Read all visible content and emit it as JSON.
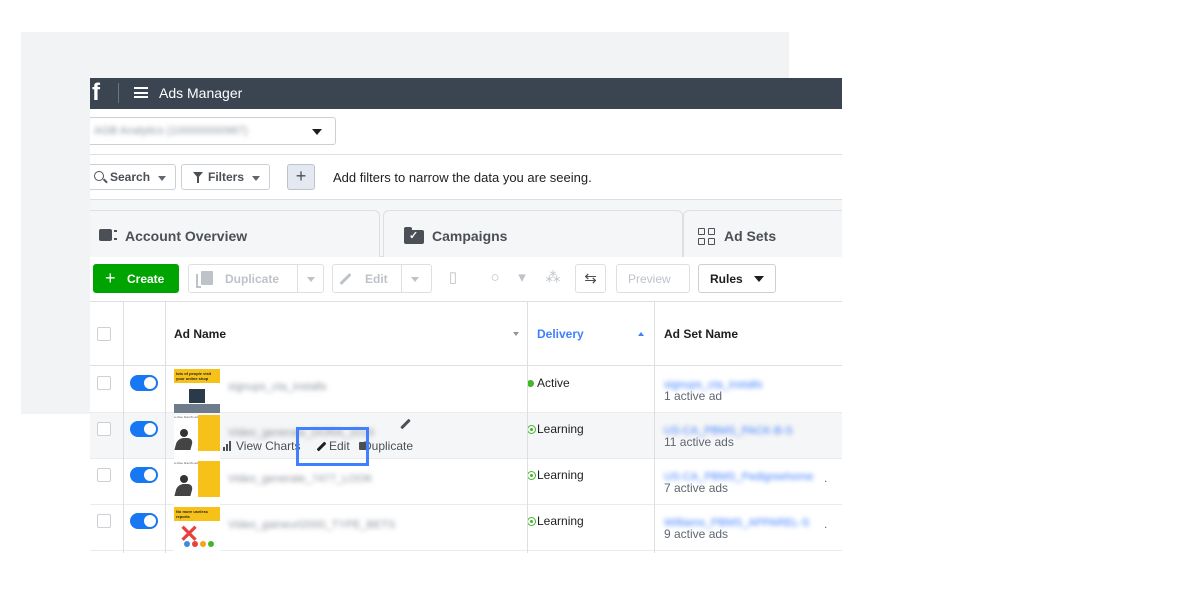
{
  "app": {
    "logo": "f",
    "title": "Ads Manager"
  },
  "account": {
    "name": "AGB Analytics (100000000987)"
  },
  "filters": {
    "search_label": "Search",
    "filters_label": "Filters",
    "add_label": "+",
    "hint": "Add filters to narrow the data you are seeing."
  },
  "tabs": [
    {
      "label": "Account Overview",
      "icon": "overview-icon"
    },
    {
      "label": "Campaigns",
      "icon": "folder-check-icon"
    },
    {
      "label": "Ad Sets",
      "icon": "grid-icon"
    }
  ],
  "toolbar": {
    "create_label": "Create",
    "duplicate_label": "Duplicate",
    "edit_label": "Edit",
    "preview_label": "Preview",
    "rules_label": "Rules"
  },
  "table": {
    "columns": [
      "Ad Name",
      "Delivery",
      "Ad Set Name"
    ],
    "rows": [
      {
        "ad_name": "signups_cta_installs",
        "delivery": "Active",
        "adset_name": "signups_cta_installs",
        "adset_count": "1 active ad"
      },
      {
        "ad_name": "Video_generate_DORA_2019",
        "delivery": "Learning",
        "adset_name": "US-CA_PBMS_PACK-B-S",
        "adset_count": "11 active ads"
      },
      {
        "ad_name": "Video_generate_7477_LOOK",
        "delivery": "Learning",
        "adset_name": "US-CA_PBMS_Pedigreehome",
        "adset_count": "7 active ads"
      },
      {
        "ad_name": "Video_gaineurl2000_TYPE_BETS",
        "delivery": "Learning",
        "adset_name": "Williams_PBMS_APPAREL-S",
        "adset_count": "9 active ads"
      }
    ]
  },
  "row_actions": {
    "view_charts": "View Charts",
    "edit": "Edit",
    "duplicate": "Duplicate"
  },
  "thumbs": {
    "promo_text": "lots of people visit your online shop",
    "caption": "a shoe brand's ad",
    "no_more": "No more useless reports"
  },
  "colors": {
    "topbar": "#3b4551",
    "accent": "#4080ff",
    "create": "#00a400",
    "active": "#42b72a",
    "toggle": "#1877f2"
  }
}
